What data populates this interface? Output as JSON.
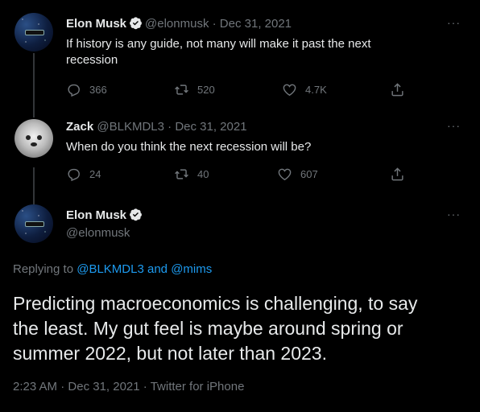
{
  "tweets": [
    {
      "name": "Elon Musk",
      "handle": "@elonmusk",
      "date": "Dec 31, 2021",
      "sep": "·",
      "text_line1": "If history is any guide, not many will make it past the next",
      "text_line2": "recession",
      "replies": "366",
      "retweets": "520",
      "likes": "4.7K"
    },
    {
      "name": "Zack",
      "handle": "@BLKMDL3",
      "date": "Dec 31, 2021",
      "sep": "·",
      "text": "When do you think the next recession will be?",
      "replies": "24",
      "retweets": "40",
      "likes": "607"
    }
  ],
  "main_tweet": {
    "name": "Elon Musk",
    "handle": "@elonmusk",
    "replying_prefix": "Replying to",
    "mention1": "@BLKMDL3",
    "and": "and",
    "mention2": "@mims",
    "text_line1": "Predicting macroeconomics is challenging, to say",
    "text_line2": "the least. My gut feel is maybe around spring or",
    "text_line3": "summer 2022, but not later than 2023.",
    "time": "2:23 AM",
    "date": "Dec 31, 2021",
    "source": "Twitter for iPhone",
    "sep": "·"
  },
  "more_glyph": "···",
  "colors": {
    "background": "#000000",
    "text": "#e7e9ea",
    "muted": "#71767b",
    "link": "#1d9bf0",
    "verified": "#1d9bf0"
  }
}
